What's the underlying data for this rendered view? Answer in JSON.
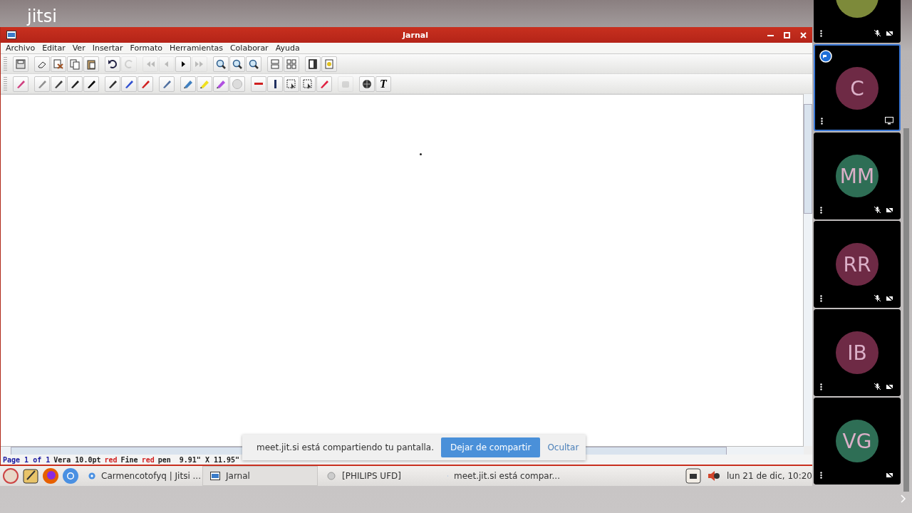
{
  "logo": {
    "text": "jitsi"
  },
  "window": {
    "title": "Jarnal"
  },
  "menu": [
    "Archivo",
    "Editar",
    "Ver",
    "Insertar",
    "Formato",
    "Herramientas",
    "Colaborar",
    "Ayuda"
  ],
  "toolbar_1": [
    [
      {
        "kind": "save",
        "disabled": false
      }
    ],
    [
      {
        "kind": "eraser",
        "disabled": false
      },
      {
        "kind": "cut",
        "disabled": false
      },
      {
        "kind": "copy",
        "disabled": false
      },
      {
        "kind": "paste",
        "disabled": false
      }
    ],
    [
      {
        "kind": "undo",
        "disabled": false
      },
      {
        "kind": "redo",
        "disabled": true
      }
    ],
    [
      {
        "kind": "first",
        "disabled": true
      },
      {
        "kind": "prev",
        "disabled": true
      },
      {
        "kind": "next",
        "disabled": false
      },
      {
        "kind": "last",
        "disabled": true
      }
    ],
    [
      {
        "kind": "zoom",
        "disabled": false
      },
      {
        "kind": "zoom",
        "disabled": false
      },
      {
        "kind": "zoom",
        "disabled": false
      }
    ],
    [
      {
        "kind": "rows",
        "disabled": false
      },
      {
        "kind": "grid",
        "disabled": false
      }
    ],
    [
      {
        "kind": "page",
        "disabled": false
      },
      {
        "kind": "image",
        "disabled": false
      }
    ]
  ],
  "toolbar_2": [
    [
      {
        "kind": "pen",
        "color": "#d04080",
        "disabled": false
      }
    ],
    [
      {
        "kind": "pen",
        "color": "#909090",
        "disabled": false
      },
      {
        "kind": "pen",
        "color": "#404040",
        "disabled": false
      },
      {
        "kind": "pen",
        "color": "#202020",
        "disabled": false
      },
      {
        "kind": "pen",
        "color": "#000000",
        "disabled": false
      }
    ],
    [
      {
        "kind": "pen",
        "color": "#303030",
        "disabled": false
      },
      {
        "kind": "pen",
        "color": "#3050d0",
        "disabled": false
      },
      {
        "kind": "pen",
        "color": "#d02020",
        "disabled": false
      }
    ],
    [
      {
        "kind": "pen",
        "color": "#5070a0",
        "disabled": false
      }
    ],
    [
      {
        "kind": "highlighter",
        "color": "#4080c0",
        "disabled": false
      },
      {
        "kind": "highlighter",
        "color": "#f0e020",
        "disabled": false
      },
      {
        "kind": "highlighter",
        "color": "#b050e0",
        "disabled": false
      },
      {
        "kind": "blank",
        "disabled": false
      }
    ],
    [
      {
        "kind": "line",
        "disabled": false
      },
      {
        "kind": "bar",
        "disabled": false
      },
      {
        "kind": "select",
        "disabled": false
      },
      {
        "kind": "select",
        "disabled": false
      },
      {
        "kind": "pen",
        "color": "#e02040",
        "disabled": false
      }
    ],
    [
      {
        "kind": "stamp",
        "disabled": true
      }
    ],
    [
      {
        "kind": "globe",
        "disabled": false
      },
      {
        "kind": "text",
        "label": "T",
        "disabled": false
      }
    ]
  ],
  "status_bar": [
    {
      "text": "Page 1 of 1",
      "color": "#1a1aa0"
    },
    {
      "text": "Vera 10.0pt",
      "color": "#202020"
    },
    {
      "text": "red",
      "color": "#d02020"
    },
    {
      "text": "Fine",
      "color": "#202020"
    },
    {
      "text": "red",
      "color": "#d02020"
    },
    {
      "text": "pen  9.91\" X 11.95\"",
      "color": "#202020"
    }
  ],
  "share_notice": {
    "text": "meet.jit.si está compartiendo tu pantalla.",
    "stop_button": "Dejar de compartir",
    "hide_link": "Ocultar"
  },
  "taskbar": {
    "launchers": [
      {
        "kind": "app"
      },
      {
        "kind": "notes"
      },
      {
        "kind": "firefox"
      },
      {
        "kind": "chromium"
      }
    ],
    "tasks": [
      {
        "label": "Carmencotofyq | Jitsi ...",
        "kind": "chrome",
        "selected": false
      },
      {
        "label": "Jarnal",
        "kind": "jarnal",
        "selected": true
      },
      {
        "label": "[PHILIPS UFD]",
        "kind": "drive",
        "selected": false
      },
      {
        "label": "meet.jit.si está compar...",
        "kind": "chrome",
        "selected": false
      }
    ],
    "clock": "lun 21 de dic, 10:20"
  },
  "participants": [
    {
      "color": "#7d8a3a",
      "selected": false,
      "dominant": false,
      "muted": true,
      "video_off": true,
      "sharing": false
    },
    {
      "initials": "C",
      "color": "#6e2a45",
      "selected": true,
      "dominant": true,
      "muted": false,
      "video_off": false,
      "sharing": true
    },
    {
      "initials": "MM",
      "color": "#2e6e55",
      "selected": false,
      "dominant": false,
      "muted": true,
      "video_off": true,
      "sharing": false
    },
    {
      "initials": "RR",
      "color": "#6e2a45",
      "selected": false,
      "dominant": false,
      "muted": true,
      "video_off": true,
      "sharing": false
    },
    {
      "initials": "IB",
      "color": "#6e2a45",
      "selected": false,
      "dominant": false,
      "muted": true,
      "video_off": true,
      "sharing": false
    },
    {
      "initials": "VG",
      "color": "#2e6e55",
      "selected": false,
      "dominant": false,
      "muted": false,
      "video_off": true,
      "sharing": false
    }
  ]
}
